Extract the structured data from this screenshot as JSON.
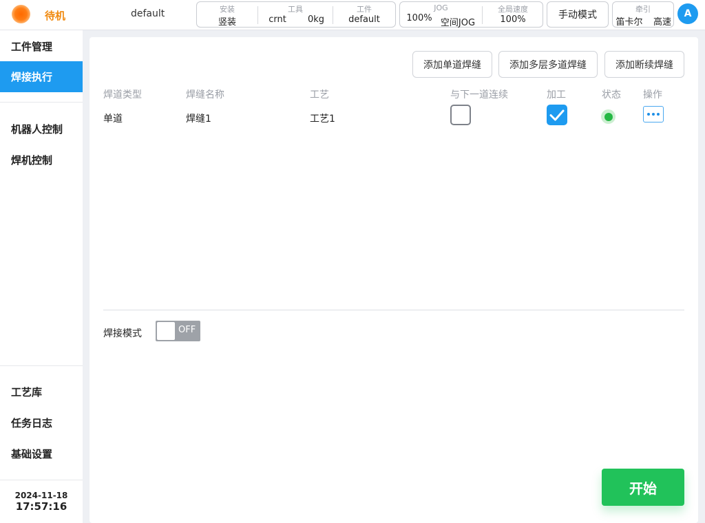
{
  "header": {
    "status": "待机",
    "project": "default",
    "install": {
      "label": "安装",
      "value": "竖装"
    },
    "tool": {
      "label": "工具",
      "name": "crnt",
      "mass": "0kg"
    },
    "workpiece": {
      "label": "工件",
      "value": "default"
    },
    "jog": {
      "label": "JOG",
      "percent": "100%",
      "mode": "空间JOG"
    },
    "global_speed": {
      "label": "全局速度",
      "value": "100%"
    },
    "mode_button": "手动模式",
    "traction": {
      "label": "牵引",
      "frame": "笛卡尔",
      "speed": "高速"
    },
    "avatar": "A"
  },
  "sidebar": {
    "items": [
      {
        "label": "工件管理",
        "active": false
      },
      {
        "label": "焊接执行",
        "active": true
      },
      {
        "label": "机器人控制",
        "active": false
      },
      {
        "label": "焊机控制",
        "active": false
      },
      {
        "label": "工艺库",
        "active": false
      },
      {
        "label": "任务日志",
        "active": false
      },
      {
        "label": "基础设置",
        "active": false
      }
    ],
    "date": "2024-11-18",
    "time": "17:57:16"
  },
  "main": {
    "buttons": {
      "add_single": "添加单道焊缝",
      "add_multi": "添加多层多道焊缝",
      "add_intermittent": "添加断续焊缝"
    },
    "columns": [
      "焊道类型",
      "焊缝名称",
      "工艺",
      "与下一道连续",
      "加工",
      "状态",
      "操作"
    ],
    "rows": [
      {
        "type": "单道",
        "name": "焊缝1",
        "process": "工艺1",
        "continuous": false,
        "machining": true,
        "status": "ok"
      }
    ],
    "weld_mode_label": "焊接模式",
    "weld_mode_state": "OFF",
    "start_button": "开始"
  },
  "colors": {
    "accent": "#1e9bf0",
    "status_orange": "#f08a10",
    "start_green": "#21c25a",
    "led_green": "#25b844"
  },
  "icons": {
    "status": "status-indicator-icon",
    "check": "checkmark-icon",
    "more": "more-dots-icon"
  }
}
